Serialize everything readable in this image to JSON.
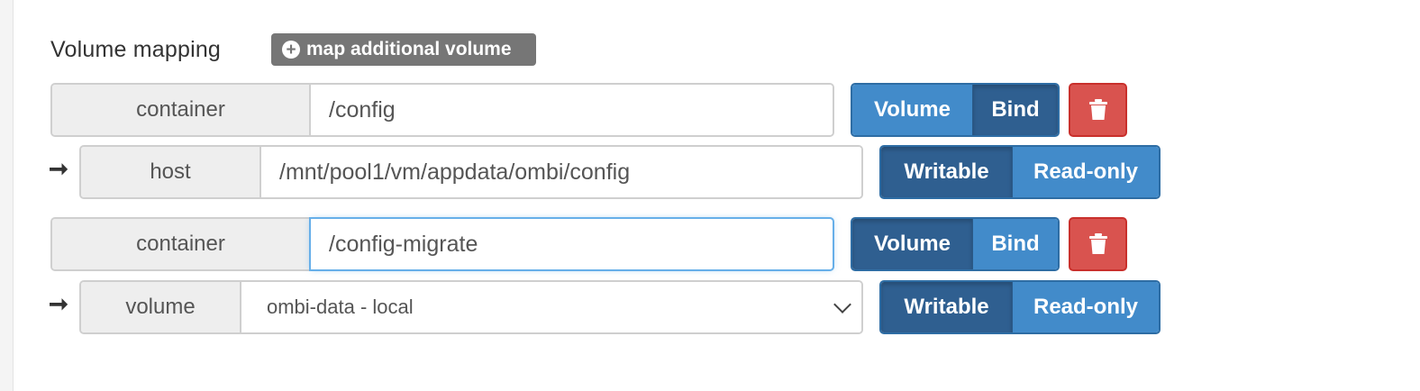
{
  "section": {
    "title": "Volume mapping",
    "add_button_label": "map additional volume"
  },
  "icons": {
    "add": "plus-circle-icon",
    "arrow": "arrow-right-icon",
    "delete": "trash-icon",
    "select": "chevron-down-icon"
  },
  "colors": {
    "primary": "#428bca",
    "primary_active": "#2f5f90",
    "danger": "#d9534f",
    "add_button": "#767676",
    "focus": "#66afe9"
  },
  "mappings": [
    {
      "container_label": "container",
      "container_value": "/config",
      "type_options": [
        "Volume",
        "Bind"
      ],
      "type_selected": "Bind",
      "host_label": "host",
      "host_value": "/mnt/pool1/vm/appdata/ombi/config",
      "mode_options": [
        "Writable",
        "Read-only"
      ],
      "mode_selected": "Writable"
    },
    {
      "container_label": "container",
      "container_value": "/config-migrate",
      "type_options": [
        "Volume",
        "Bind"
      ],
      "type_selected": "Volume",
      "host_label": "volume",
      "host_value": "ombi-data - local",
      "mode_options": [
        "Writable",
        "Read-only"
      ],
      "mode_selected": "Writable"
    }
  ]
}
